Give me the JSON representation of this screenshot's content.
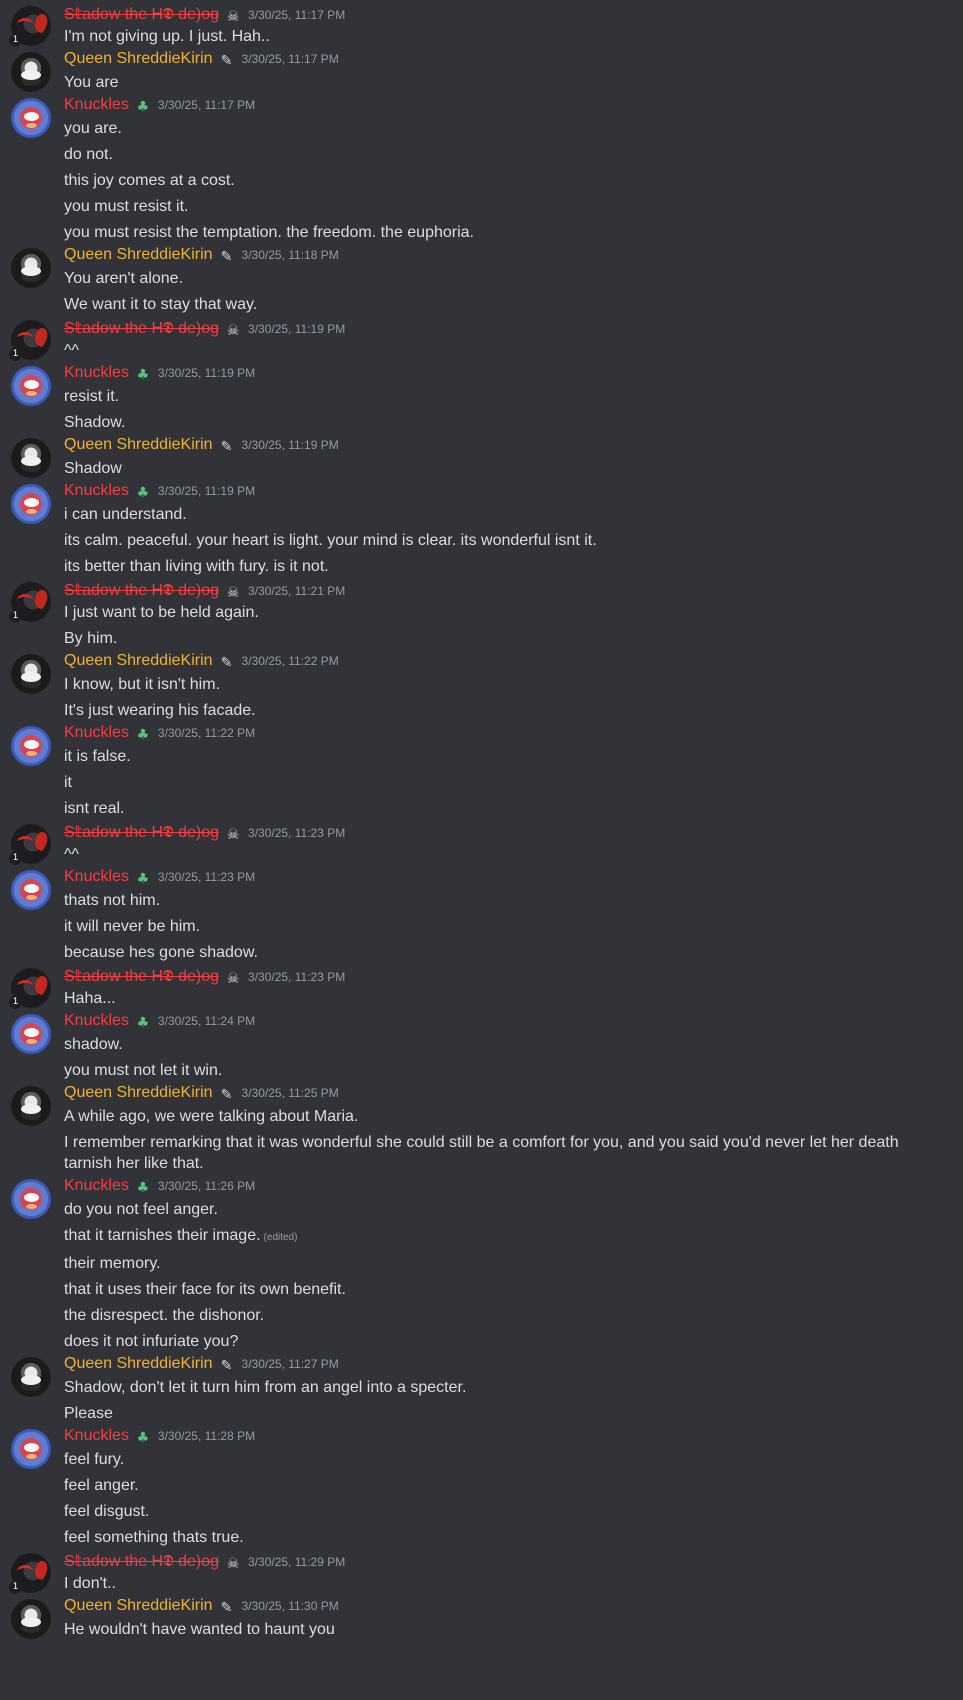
{
  "users": {
    "shadow": {
      "name": "S𝕥adow the H𝕯 de)og"
    },
    "queen": {
      "name": "Queen ShreddieKirin"
    },
    "knuckles": {
      "name": "Knuckles"
    }
  },
  "badge_text": "1",
  "edited_label": "(edited)",
  "messages": [
    {
      "user": "shadow",
      "timestamp": "3/30/25, 11:17 PM",
      "lines": [
        "I'm not giving up. I just. Hah.."
      ]
    },
    {
      "user": "queen",
      "timestamp": "3/30/25, 11:17 PM",
      "lines": [
        "You are"
      ]
    },
    {
      "user": "knuckles",
      "timestamp": "3/30/25, 11:17 PM",
      "lines": [
        "you are.",
        "do not.",
        "this joy comes at a cost.",
        "you must resist it.",
        "you must resist the temptation. the freedom. the euphoria."
      ]
    },
    {
      "user": "queen",
      "timestamp": "3/30/25, 11:18 PM",
      "lines": [
        "You aren't alone.",
        "We want it to stay that way."
      ]
    },
    {
      "user": "shadow",
      "timestamp": "3/30/25, 11:19 PM",
      "lines": [
        "^^"
      ]
    },
    {
      "user": "knuckles",
      "timestamp": "3/30/25, 11:19 PM",
      "lines": [
        "resist it.",
        "Shadow."
      ]
    },
    {
      "user": "queen",
      "timestamp": "3/30/25, 11:19 PM",
      "lines": [
        "Shadow"
      ]
    },
    {
      "user": "knuckles",
      "timestamp": "3/30/25, 11:19 PM",
      "lines": [
        "i can understand.",
        "its calm. peaceful. your heart is light. your mind is clear. its wonderful isnt it.",
        "its better than living with fury. is it not."
      ]
    },
    {
      "user": "shadow",
      "timestamp": "3/30/25, 11:21 PM",
      "lines": [
        "I just want to be held again.",
        "By him."
      ]
    },
    {
      "user": "queen",
      "timestamp": "3/30/25, 11:22 PM",
      "lines": [
        "I know, but it isn't him.",
        "It's just wearing his facade."
      ]
    },
    {
      "user": "knuckles",
      "timestamp": "3/30/25, 11:22 PM",
      "lines": [
        "it is false.",
        "it",
        "isnt real."
      ]
    },
    {
      "user": "shadow",
      "timestamp": "3/30/25, 11:23 PM",
      "lines": [
        "^^"
      ]
    },
    {
      "user": "knuckles",
      "timestamp": "3/30/25, 11:23 PM",
      "lines": [
        "thats not him.",
        "it will never be him.",
        "because hes gone shadow."
      ]
    },
    {
      "user": "shadow",
      "timestamp": "3/30/25, 11:23 PM",
      "lines": [
        "Haha..."
      ]
    },
    {
      "user": "knuckles",
      "timestamp": "3/30/25, 11:24 PM",
      "lines": [
        "shadow.",
        "you must not let it win."
      ]
    },
    {
      "user": "queen",
      "timestamp": "3/30/25, 11:25 PM",
      "lines": [
        "A while ago, we were talking about Maria.",
        "I remember remarking that it was wonderful she could still be a comfort for you, and you said you'd never let her death tarnish her like that."
      ]
    },
    {
      "user": "knuckles",
      "timestamp": "3/30/25, 11:26 PM",
      "lines": [
        "do you not feel anger.",
        "that it tarnishes their image.",
        "their memory.",
        "that it uses their face for its own benefit.",
        "the disrespect. the dishonor.",
        "does it not infuriate you?"
      ],
      "edited_line": 1
    },
    {
      "user": "queen",
      "timestamp": "3/30/25, 11:27 PM",
      "lines": [
        "Shadow, don't let it turn him from an angel into a specter.",
        "Please"
      ]
    },
    {
      "user": "knuckles",
      "timestamp": "3/30/25, 11:28 PM",
      "lines": [
        "feel fury.",
        "feel anger.",
        "feel disgust.",
        "feel something thats true."
      ]
    },
    {
      "user": "shadow",
      "timestamp": "3/30/25, 11:29 PM",
      "lines": [
        "I don't.."
      ]
    },
    {
      "user": "queen",
      "timestamp": "3/30/25, 11:30 PM",
      "lines": [
        "He wouldn't have wanted to haunt you"
      ]
    }
  ]
}
